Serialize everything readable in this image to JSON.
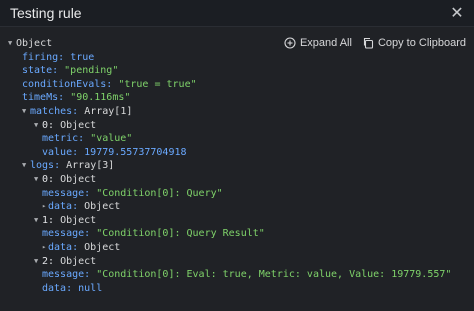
{
  "header": {
    "title": "Testing rule",
    "close_label": "✕"
  },
  "actions": {
    "expand_all": "Expand All",
    "copy": "Copy to Clipboard"
  },
  "tree": {
    "root_type": "Object",
    "firing_key": "firing:",
    "firing_val": "true",
    "state_key": "state:",
    "state_val": "\"pending\"",
    "condEvals_key": "conditionEvals:",
    "condEvals_val": "\"true = true\"",
    "timeMs_key": "timeMs:",
    "timeMs_val": "\"90.116ms\"",
    "matches_key": "matches:",
    "matches_type": "Array[1]",
    "m0_idx": "0:",
    "m0_type": "Object",
    "m0_metric_key": "metric:",
    "m0_metric_val": "\"value\"",
    "m0_value_key": "value:",
    "m0_value_val": "19779.55737704918",
    "logs_key": "logs:",
    "logs_type": "Array[3]",
    "l0_idx": "0:",
    "l0_type": "Object",
    "l0_msg_key": "message:",
    "l0_msg_val": "\"Condition[0]: Query\"",
    "l0_data_key": "data:",
    "l0_data_type": "Object",
    "l1_idx": "1:",
    "l1_type": "Object",
    "l1_msg_key": "message:",
    "l1_msg_val": "\"Condition[0]: Query Result\"",
    "l1_data_key": "data:",
    "l1_data_type": "Object",
    "l2_idx": "2:",
    "l2_type": "Object",
    "l2_msg_key": "message:",
    "l2_msg_val": "\"Condition[0]: Eval: true, Metric: value, Value: 19779.557\"",
    "l2_data_key": "data:",
    "l2_data_val": "null"
  }
}
